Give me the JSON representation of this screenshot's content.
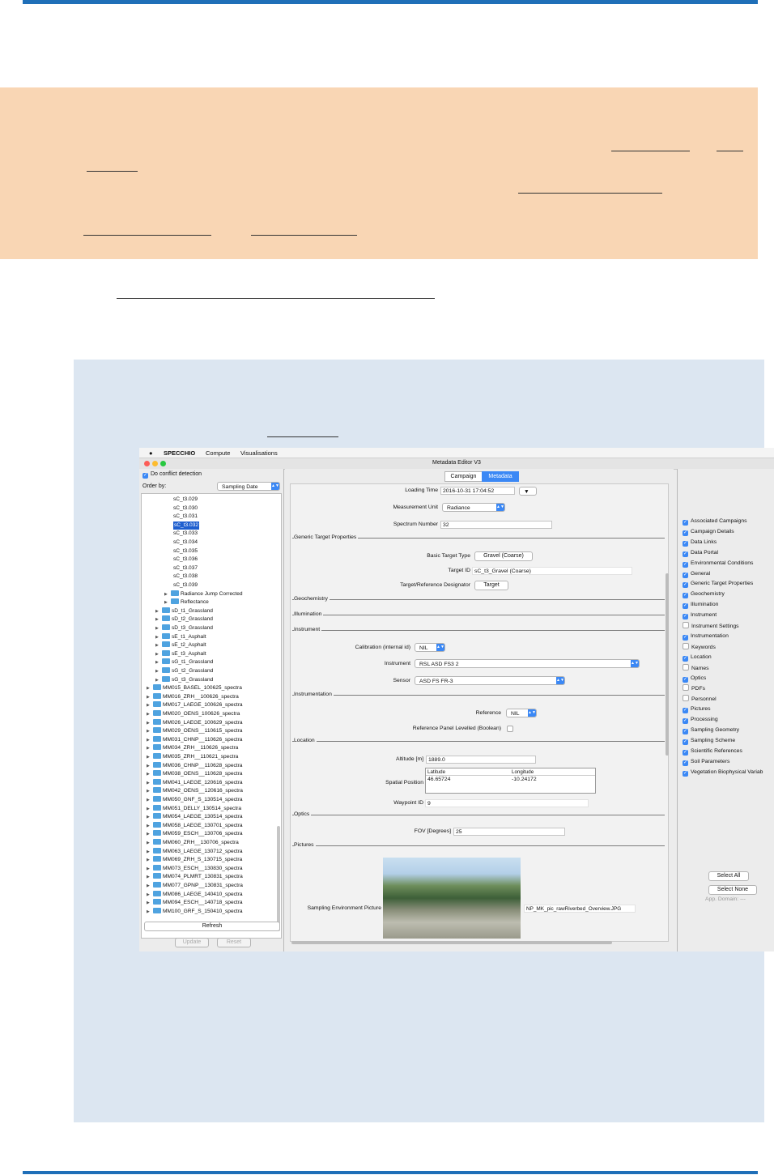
{
  "app": {
    "menu": [
      "SPECCHIO",
      "Compute",
      "Visualisations"
    ],
    "window_title": "Metadata Editor V3"
  },
  "left_panel": {
    "conflict_label": "Do conflict detection",
    "order_label": "Order by:",
    "order_value": "Sampling Date",
    "tree_items": [
      {
        "text": "sC_t3.029",
        "level": 4,
        "folder": false,
        "arrow": false,
        "selected": false
      },
      {
        "text": "sC_t3.030",
        "level": 4,
        "folder": false,
        "arrow": false,
        "selected": false
      },
      {
        "text": "sC_t3.031",
        "level": 4,
        "folder": false,
        "arrow": false,
        "selected": false
      },
      {
        "text": "sC_t3.032",
        "level": 4,
        "folder": false,
        "arrow": false,
        "selected": true
      },
      {
        "text": "sC_t3.033",
        "level": 4,
        "folder": false,
        "arrow": false,
        "selected": false
      },
      {
        "text": "sC_t3.034",
        "level": 4,
        "folder": false,
        "arrow": false,
        "selected": false
      },
      {
        "text": "sC_t3.035",
        "level": 4,
        "folder": false,
        "arrow": false,
        "selected": false
      },
      {
        "text": "sC_t3.036",
        "level": 4,
        "folder": false,
        "arrow": false,
        "selected": false
      },
      {
        "text": "sC_t3.037",
        "level": 4,
        "folder": false,
        "arrow": false,
        "selected": false
      },
      {
        "text": "sC_t3.038",
        "level": 4,
        "folder": false,
        "arrow": false,
        "selected": false
      },
      {
        "text": "sC_t3.039",
        "level": 4,
        "folder": false,
        "arrow": false,
        "selected": false
      },
      {
        "text": "Radiance Jump Corrected",
        "level": 3,
        "folder": true,
        "arrow": true,
        "selected": false
      },
      {
        "text": "Reflectance",
        "level": 3,
        "folder": true,
        "arrow": true,
        "selected": false
      },
      {
        "text": "sD_t1_Grassland",
        "level": 2,
        "folder": true,
        "arrow": true,
        "selected": false
      },
      {
        "text": "sD_t2_Grassland",
        "level": 2,
        "folder": true,
        "arrow": true,
        "selected": false
      },
      {
        "text": "sD_t3_Grassland",
        "level": 2,
        "folder": true,
        "arrow": true,
        "selected": false
      },
      {
        "text": "sE_t1_Asphalt",
        "level": 2,
        "folder": true,
        "arrow": true,
        "selected": false
      },
      {
        "text": "sE_t2_Asphalt",
        "level": 2,
        "folder": true,
        "arrow": true,
        "selected": false
      },
      {
        "text": "sE_t3_Asphalt",
        "level": 2,
        "folder": true,
        "arrow": true,
        "selected": false
      },
      {
        "text": "sG_t1_Grassland",
        "level": 2,
        "folder": true,
        "arrow": true,
        "selected": false
      },
      {
        "text": "sG_t2_Grassland",
        "level": 2,
        "folder": true,
        "arrow": true,
        "selected": false
      },
      {
        "text": "sG_t3_Grassland",
        "level": 2,
        "folder": true,
        "arrow": true,
        "selected": false
      },
      {
        "text": "MM015_BASEL_100625_spectra",
        "level": 1,
        "folder": true,
        "arrow": true,
        "selected": false
      },
      {
        "text": "MM016_ZRH__100626_spectra",
        "level": 1,
        "folder": true,
        "arrow": true,
        "selected": false
      },
      {
        "text": "MM017_LAEGE_100626_spectra",
        "level": 1,
        "folder": true,
        "arrow": true,
        "selected": false
      },
      {
        "text": "MM020_OENS_100626_spectra",
        "level": 1,
        "folder": true,
        "arrow": true,
        "selected": false
      },
      {
        "text": "MM026_LAEGE_100629_spectra",
        "level": 1,
        "folder": true,
        "arrow": true,
        "selected": false
      },
      {
        "text": "MM029_OENS__110615_spectra",
        "level": 1,
        "folder": true,
        "arrow": true,
        "selected": false
      },
      {
        "text": "MM031_CHNP__110626_spectra",
        "level": 1,
        "folder": true,
        "arrow": true,
        "selected": false
      },
      {
        "text": "MM034_ZRH__110626_spectra",
        "level": 1,
        "folder": true,
        "arrow": true,
        "selected": false
      },
      {
        "text": "MM035_ZRH__110621_spectra",
        "level": 1,
        "folder": true,
        "arrow": true,
        "selected": false
      },
      {
        "text": "MM036_CHNP__110628_spectra",
        "level": 1,
        "folder": true,
        "arrow": true,
        "selected": false
      },
      {
        "text": "MM038_OENS__110628_spectra",
        "level": 1,
        "folder": true,
        "arrow": true,
        "selected": false
      },
      {
        "text": "MM041_LAEGE_120616_spectra",
        "level": 1,
        "folder": true,
        "arrow": true,
        "selected": false
      },
      {
        "text": "MM042_OENS__120616_spectra",
        "level": 1,
        "folder": true,
        "arrow": true,
        "selected": false
      },
      {
        "text": "MM050_GNF_S_130514_spectra",
        "level": 1,
        "folder": true,
        "arrow": true,
        "selected": false
      },
      {
        "text": "MM051_DELLY_130514_spectra",
        "level": 1,
        "folder": true,
        "arrow": true,
        "selected": false
      },
      {
        "text": "MM054_LAEGE_130514_spectra",
        "level": 1,
        "folder": true,
        "arrow": true,
        "selected": false
      },
      {
        "text": "MM058_LAEGE_130701_spectra",
        "level": 1,
        "folder": true,
        "arrow": true,
        "selected": false
      },
      {
        "text": "MM059_ESCH__130706_spectra",
        "level": 1,
        "folder": true,
        "arrow": true,
        "selected": false
      },
      {
        "text": "MM060_ZRH__130706_spectra",
        "level": 1,
        "folder": true,
        "arrow": true,
        "selected": false
      },
      {
        "text": "MM063_LAEGE_130712_spectra",
        "level": 1,
        "folder": true,
        "arrow": true,
        "selected": false
      },
      {
        "text": "MM069_ZRH_S_130715_spectra",
        "level": 1,
        "folder": true,
        "arrow": true,
        "selected": false
      },
      {
        "text": "MM073_ESCH__130830_spectra",
        "level": 1,
        "folder": true,
        "arrow": true,
        "selected": false
      },
      {
        "text": "MM074_PLMRT_130831_spectra",
        "level": 1,
        "folder": true,
        "arrow": true,
        "selected": false
      },
      {
        "text": "MM077_GPNP__130831_spectra",
        "level": 1,
        "folder": true,
        "arrow": true,
        "selected": false
      },
      {
        "text": "MM086_LAEGE_140410_spectra",
        "level": 1,
        "folder": true,
        "arrow": true,
        "selected": false
      },
      {
        "text": "MM094_ESCH__140718_spectra",
        "level": 1,
        "folder": true,
        "arrow": true,
        "selected": false
      },
      {
        "text": "MM100_GRF_S_150410_spectra",
        "level": 1,
        "folder": true,
        "arrow": true,
        "selected": false
      }
    ],
    "refresh_label": "Refresh",
    "update_label": "Update",
    "reset_label": "Reset"
  },
  "center": {
    "tabs": [
      "Campaign",
      "Metadata"
    ],
    "active_tab": 1,
    "loading_time_label": "Loading Time",
    "loading_time_value": "2016-10-31 17:04:52",
    "measurement_unit_label": "Measurement Unit",
    "measurement_unit_value": "Radiance",
    "spectrum_number_label": "Spectrum Number",
    "spectrum_number_value": "32",
    "sections": [
      "Generic Target Properties",
      "Geochemistry",
      "Illumination",
      "Instrument",
      "Instrumentation",
      "Location",
      "Optics",
      "Pictures"
    ],
    "basic_target_type_label": "Basic Target Type",
    "basic_target_type_value": "Gravel (Coarse)",
    "target_id_label": "Target ID",
    "target_id_value": "sC_t3_Gravel (Coarse)",
    "target_ref_label": "Target/Reference Designator",
    "target_ref_value": "Target",
    "calibration_label": "Calibration (internal id)",
    "calibration_value": "NIL",
    "instrument_label": "Instrument",
    "instrument_value": "RSL ASD FS3 2",
    "sensor_label": "Sensor",
    "sensor_value": "ASD FS FR-3",
    "reference_label": "Reference",
    "reference_value": "NIL",
    "ref_panel_label": "Reference Panel Levelled (Boolean)",
    "altitude_label": "Altitude [m]",
    "altitude_value": "1889.0",
    "spatial_label": "Spatial Position",
    "lat_header": "Latitude",
    "lon_header": "Longitude",
    "lat_value": "46.65724",
    "lon_value": "-10.24172",
    "waypoint_label": "Waypoint ID",
    "waypoint_value": "9",
    "fov_label": "FOV [Degrees]",
    "fov_value": "25",
    "picture_label": "Sampling Environment Picture",
    "picture_filename": "NP_MK_pic_rawRiverbed_Overview.JPG"
  },
  "right_panel": {
    "options": [
      {
        "label": "Associated Campaigns",
        "checked": true
      },
      {
        "label": "Campaign Details",
        "checked": true
      },
      {
        "label": "Data Links",
        "checked": true
      },
      {
        "label": "Data Portal",
        "checked": true
      },
      {
        "label": "Environmental Conditions",
        "checked": true
      },
      {
        "label": "General",
        "checked": true
      },
      {
        "label": "Generic Target Properties",
        "checked": true
      },
      {
        "label": "Geochemistry",
        "checked": true
      },
      {
        "label": "Illumination",
        "checked": true
      },
      {
        "label": "Instrument",
        "checked": true
      },
      {
        "label": "Instrument Settings",
        "checked": false
      },
      {
        "label": "Instrumentation",
        "checked": true
      },
      {
        "label": "Keywords",
        "checked": false
      },
      {
        "label": "Location",
        "checked": true
      },
      {
        "label": "Names",
        "checked": false
      },
      {
        "label": "Optics",
        "checked": true
      },
      {
        "label": "PDFs",
        "checked": false
      },
      {
        "label": "Personnel",
        "checked": false
      },
      {
        "label": "Pictures",
        "checked": true
      },
      {
        "label": "Processing",
        "checked": true
      },
      {
        "label": "Sampling Geometry",
        "checked": true
      },
      {
        "label": "Sampling Scheme",
        "checked": true
      },
      {
        "label": "Scientific References",
        "checked": true
      },
      {
        "label": "Soil Parameters",
        "checked": true
      },
      {
        "label": "Vegetation Biophysical Variab",
        "checked": true
      }
    ],
    "select_all_label": "Select All",
    "select_none_label": "Select None",
    "app_domain_label": "App. Domain: ---"
  }
}
